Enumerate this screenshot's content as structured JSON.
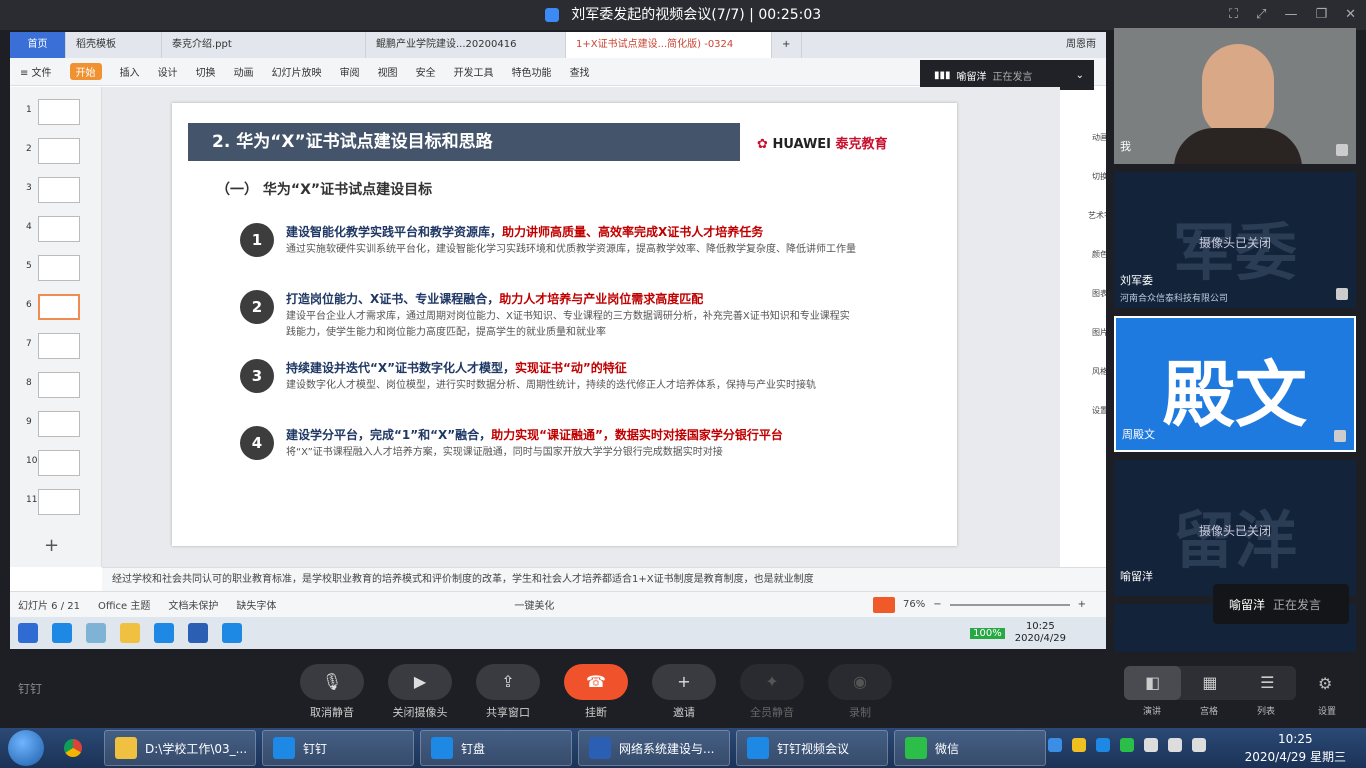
{
  "window": {
    "title": "刘军委发起的视频会议(7/7) | 00:25:03"
  },
  "wps": {
    "tabs": [
      "首页",
      "稻壳模板",
      "泰克介绍.ppt",
      "鲲鹏产业学院建设...20200416",
      "1+X证书试点建设...简化版) -0324",
      "+"
    ],
    "user": "周恩雨",
    "menu": [
      "≡ 文件",
      "开始",
      "插入",
      "设计",
      "切换",
      "动画",
      "幻灯片放映",
      "审阅",
      "视图",
      "安全",
      "开发工具",
      "特色功能",
      "查找"
    ]
  },
  "speaker_bar": {
    "name": "喻留洋",
    "status": "正在发言"
  },
  "thumbnails": [
    "1",
    "2",
    "3",
    "4",
    "5",
    "6",
    "7",
    "8",
    "9",
    "10",
    "11"
  ],
  "slide": {
    "title": "2. 华为“X”证书试点建设目标和思路",
    "logo_huawei": "HUAWEI",
    "logo_tech": "泰克教育",
    "subtitle": "（一） 华为“X”证书试点建设目标",
    "items": [
      {
        "num": "1",
        "head": "建设智能化教学实践平台和教学资源库，",
        "head_red": "助力讲师高质量、高效率完成X证书人才培养任务",
        "body": "通过实施软硬件实训系统平台化，建设智能化学习实践环境和优质教学资源库，提高教学效率、降低教学复杂度、降低讲师工作量"
      },
      {
        "num": "2",
        "head": "打造岗位能力、X证书、专业课程融合，",
        "head_red": "助力人才培养与产业岗位需求高度匹配",
        "body": "建设平台企业人才需求库，通过周期对岗位能力、X证书知识、专业课程的三方数据调研分析，补充完善X证书知识和专业课程实践能力，使学生能力和岗位能力高度匹配，提高学生的就业质量和就业率"
      },
      {
        "num": "3",
        "head": "持续建设并迭代“X”证书数字化人才模型，",
        "head_red": "实现证书“动”的特征",
        "body": "建设数字化人才模型、岗位模型，进行实时数据分析、周期性统计，持续的迭代修正人才培养体系，保持与产业实时接轨"
      },
      {
        "num": "4",
        "head": "建设学分平台，完成“1”和“X”融合，",
        "head_red": "助力实现“课证融通”，数据实时对接国家学分银行平台",
        "body": "将“X”证书课程融入人才培养方案，实现课证融通，同时与国家开放大学学分银行完成数据实时对接"
      }
    ]
  },
  "notes": "经过学校和社会共同认可的职业教育标准，是学校职业教育的培养模式和评价制度的改革，学生和社会人才培养都适合1+X证书制度是教育制度，也是就业制度",
  "status": {
    "slide": "幻灯片 6 / 21",
    "theme": "Office 主题",
    "protect": "文档未保护",
    "font": "缺失字体",
    "beautify": "一键美化",
    "zoom": "76%"
  },
  "inner_taskbar": {
    "battery": "100%",
    "time": "10:25",
    "date": "2020/4/29"
  },
  "right_tools": [
    "动画",
    "切换",
    "艺术字",
    "颜色",
    "图表",
    "图片",
    "风格",
    "设置"
  ],
  "participants": [
    {
      "name": "我",
      "camera": "on"
    },
    {
      "name": "刘军委",
      "short": "军委",
      "org": "河南合众信泰科技有限公司",
      "camera_status": "摄像头已关闭"
    },
    {
      "name": "周殿文",
      "short": "殿文"
    },
    {
      "name": "喻留洋",
      "short": "留洋",
      "camera_status": "摄像头已关闭"
    }
  ],
  "toast": {
    "name": "喻留洋",
    "status": "正在发言"
  },
  "controls": [
    "取消静音",
    "关闭摄像头",
    "共享窗口",
    "挂断",
    "邀请",
    "全员静音",
    "录制"
  ],
  "brand": "钉钉",
  "layout_labels": [
    "演讲",
    "宫格",
    "列表",
    "设置"
  ],
  "win_taskbar": {
    "items": [
      "D:\\学校工作\\03_...",
      "钉钉",
      "钉盘",
      "网络系统建设与...",
      "钉钉视频会议",
      "微信"
    ],
    "time": "10:25",
    "date": "2020/4/29 星期三"
  },
  "colors": {
    "accent": "#1f7ae0",
    "hangup": "#f0522c",
    "slide_banner": "#44546a",
    "highlight_red": "#c00000"
  }
}
